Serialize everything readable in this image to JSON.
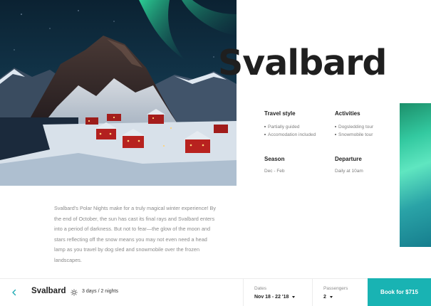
{
  "destination": {
    "title": "Svalbard"
  },
  "info": {
    "travel_style": {
      "label": "Travel style",
      "items": [
        "Partially guided",
        "Accomodation included"
      ]
    },
    "activities": {
      "label": "Activities",
      "items": [
        "Dogsledding tour",
        "Snowmobile tour"
      ]
    },
    "season": {
      "label": "Season",
      "value": "Dec - Feb"
    },
    "departure": {
      "label": "Departure",
      "value": "Daily at 10am"
    }
  },
  "description": "Svalbard’s Polar Nights make for a truly magical winter experience! By the end of October, the sun has cast its final rays and Svalbard enters into a period of darkness. But not to fear—the glow of the moon and stars reflecting off the snow means you may not even need a head lamp as you travel by dog sled and snowmobile over the frozen landscapes.",
  "bottom_bar": {
    "back_icon": "chevron-left-icon",
    "destination": "Svalbard",
    "duration_icon": "sun-icon",
    "duration": "3 days / 2 nights",
    "dates": {
      "label": "Dates",
      "value": "Nov 18 - 22 '18"
    },
    "passengers": {
      "label": "Passengers",
      "value": "2"
    },
    "book_button": "Book for $715"
  },
  "colors": {
    "accent": "#19b3b3",
    "title": "#1f1f1f",
    "muted_text": "#8b8b8b"
  }
}
